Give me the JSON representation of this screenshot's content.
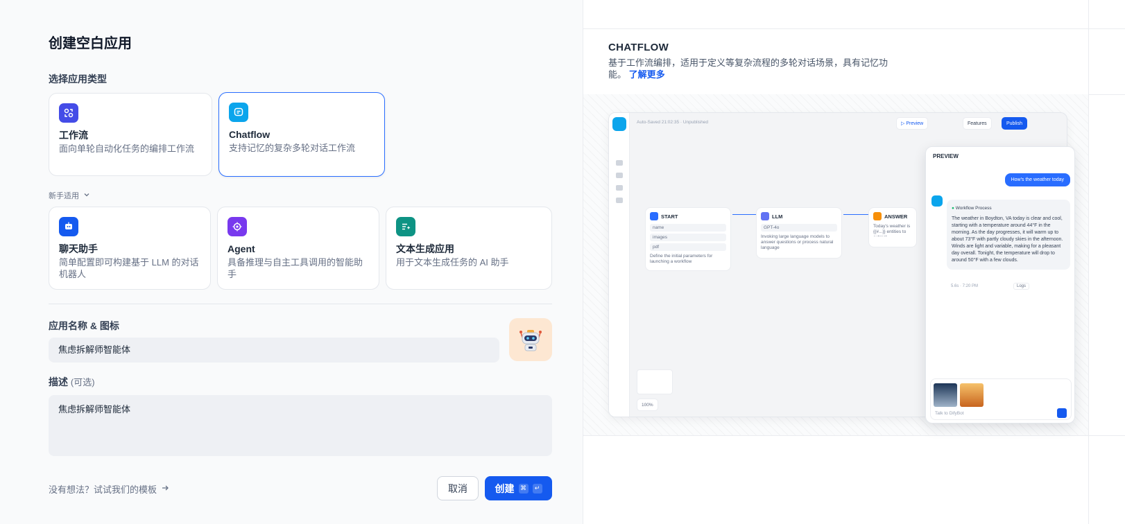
{
  "page": {
    "title": "创建空白应用",
    "section_type": "选择应用类型",
    "newbie_label": "新手适用",
    "name_label": "应用名称 & 图标",
    "desc_label": "描述",
    "desc_optional": "(可选)",
    "name_value": "焦虑拆解师智能体",
    "desc_value": "焦虑拆解师智能体",
    "template_link": "没有想法？试试我们的模板",
    "cancel": "取消",
    "create": "创建",
    "kbd_cmd": "⌘",
    "kbd_enter": "↵"
  },
  "app_types": [
    {
      "title": "工作流",
      "desc": "面向单轮自动化任务的编排工作流",
      "color": "#444ce7",
      "icon": "workflow-icon"
    },
    {
      "title": "Chatflow",
      "desc": "支持记忆的复杂多轮对话工作流",
      "color": "#0ba5ec",
      "icon": "chatflow-icon"
    }
  ],
  "beginner_types": [
    {
      "title": "聊天助手",
      "desc": "简单配置即可构建基于 LLM 的对话机器人",
      "color": "#155aef",
      "icon": "chat-assistant-icon"
    },
    {
      "title": "Agent",
      "desc": "具备推理与自主工具调用的智能助手",
      "color": "#7839ee",
      "icon": "agent-icon"
    },
    {
      "title": "文本生成应用",
      "desc": "用于文本生成任务的 AI 助手",
      "color": "#0e9384",
      "icon": "text-generation-icon"
    }
  ],
  "preview_panel": {
    "title": "CHATFLOW",
    "desc": "基于工作流编排，适用于定义等复杂流程的多轮对话场景，具有记忆功能。",
    "learn_more": "了解更多",
    "mock": {
      "autosave": "Auto-Saved 21:02:35 · Unpublished",
      "preview_btn": "▷ Preview",
      "features_btn": "Features",
      "publish_btn": "Publish",
      "start": "START",
      "llm": "LLM",
      "answer": "ANSWER",
      "start_rows": [
        "name",
        "images",
        "pdf"
      ],
      "start_hint": "Define the initial parameters for launching a workflow",
      "llm_model": "GPT-4o",
      "llm_hint": "Invoking large language models to answer questions or process natural language",
      "answer_hint": "Today's weather is {{#...}} entities to extract.",
      "zoom": "100%",
      "preview_title": "PREVIEW",
      "user_msg": "How's the weather today",
      "workflow_process": "Workflow Process",
      "bot_msg": "The weather in Boydton, VA today is clear and cool, starting with a temperature around 44°F in the morning. As the day progresses, it will warm up to about 73°F with partly cloudy skies in the afternoon. Winds are light and variable, making for a pleasant day overall. Tonight, the temperature will drop to around 50°F with a few clouds.",
      "time": "5.6s · 7:20 PM",
      "logs": "Logs",
      "input_placeholder": "Talk to DifyBot"
    }
  },
  "colors": {
    "primary": "#155aef",
    "selected_border": "#296dff"
  }
}
